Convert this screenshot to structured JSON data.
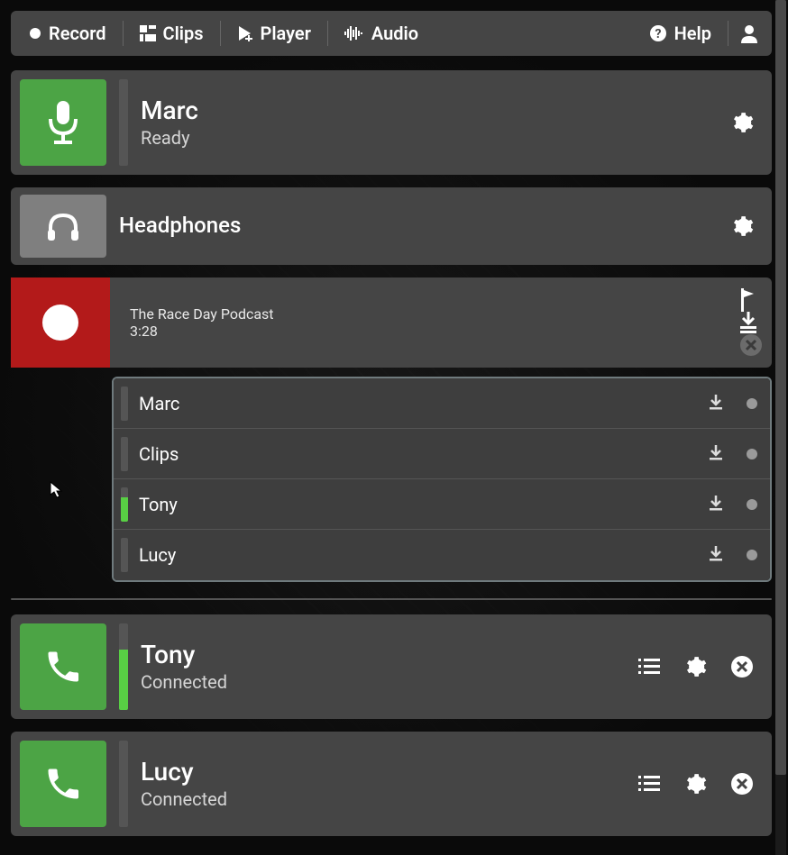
{
  "toolbar": {
    "record": "Record",
    "clips": "Clips",
    "player": "Player",
    "audio": "Audio",
    "help": "Help"
  },
  "local": {
    "name": "Marc",
    "status": "Ready"
  },
  "headphones": {
    "label": "Headphones"
  },
  "recording": {
    "title": "The Race Day Podcast",
    "elapsed": "3:28",
    "tracks": [
      {
        "name": "Marc",
        "level": 0
      },
      {
        "name": "Clips",
        "level": 0
      },
      {
        "name": "Tony",
        "level": 70
      },
      {
        "name": "Lucy",
        "level": 0
      }
    ]
  },
  "guests": [
    {
      "name": "Tony",
      "status": "Connected",
      "level": 70
    },
    {
      "name": "Lucy",
      "status": "Connected",
      "level": 0
    }
  ]
}
